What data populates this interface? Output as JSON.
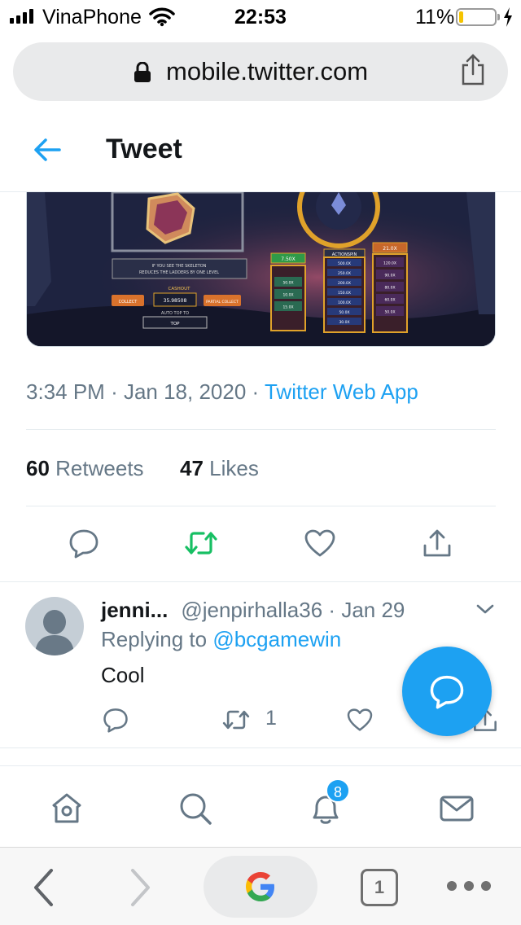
{
  "status_bar": {
    "carrier": "VinaPhone",
    "time": "22:53",
    "battery_percent": "11%",
    "battery_level": 0.11,
    "battery_color": "#f5c400"
  },
  "address_bar": {
    "url": "mobile.twitter.com",
    "lock_icon": "lock-icon",
    "share_icon": "share-icon"
  },
  "header": {
    "back_icon": "arrow-left-icon",
    "title": "Tweet"
  },
  "tweet": {
    "time": "3:34 PM",
    "date": "Jan 18, 2020",
    "source": "Twitter Web App",
    "retweets_count": "60",
    "retweets_label": "Retweets",
    "likes_count": "47",
    "likes_label": "Likes",
    "image_texts": {
      "multiplier_1": "7.50X",
      "multiplier_2": "21.0X",
      "action_label": "ACTIONSPIN",
      "cashout_label": "CASHOUT",
      "cashout_value": "35.98508",
      "collect_label": "COLLECT",
      "partial_collect_label": "PARTIAL COLLECT",
      "auto_label": "AUTO TOP TO",
      "auto_value": "TOP",
      "skeleton_note_line1": "IF YOU SEE THE SKELETON",
      "skeleton_note_line2": "REDUCES THE LADDERS BY ONE LEVEL",
      "ladder_left": [
        "50.0X",
        "10.0X",
        "15.0X"
      ],
      "ladder_mid": [
        "500.0X",
        "250.0X",
        "200.0X",
        "150.0X",
        "100.0X",
        "50.0X",
        "30.0X"
      ],
      "ladder_right": [
        "120.0X",
        "90.0X",
        "80.0X",
        "60.0X",
        "50.0X"
      ]
    }
  },
  "actions": {
    "reply_icon": "comment-icon",
    "retweet_icon": "retweet-icon",
    "like_icon": "heart-icon",
    "share_icon": "share-icon",
    "retweet_color": "#17bf63"
  },
  "reply": {
    "name": "jenni...",
    "handle": "@jenpirhalla36",
    "separator": "·",
    "date": "Jan 29",
    "replying_prefix": "Replying to",
    "replying_to": "@bcgamewin",
    "text": "Cool",
    "retweet_count": "1"
  },
  "fab": {
    "icon": "compose-reply-icon",
    "color": "#1da1f2"
  },
  "twitter_nav": {
    "items": [
      "home-icon",
      "search-icon",
      "notifications-icon",
      "messages-icon"
    ],
    "notification_badge": "8"
  },
  "safari_toolbar": {
    "back_icon": "chevron-left-icon",
    "forward_icon": "chevron-right-icon",
    "google_icon": "google-icon",
    "tab_count": "1",
    "more_icon": "more-icon"
  }
}
